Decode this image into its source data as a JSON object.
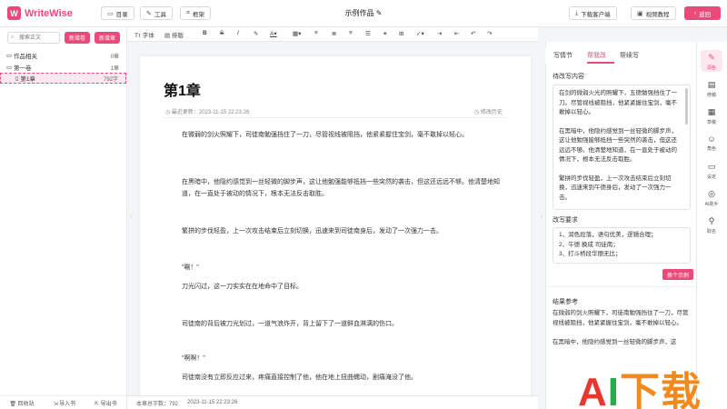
{
  "app": {
    "logo_mark": "W",
    "name": "WriteWise"
  },
  "header": {
    "catalog_label": "目录",
    "tools_label": "工具",
    "frame_label": "框架",
    "doc_title": "示例作品",
    "download_label": "下载客户端",
    "video_label": "视频教程",
    "back_label": "返回"
  },
  "sidebar": {
    "search_placeholder": "搜索正文",
    "new_volume": "新增卷",
    "new_chapter": "新增章",
    "tree": [
      {
        "label": "作品相关",
        "count": "0章"
      },
      {
        "label": "第一卷",
        "count": "1章"
      },
      {
        "label": "第1章",
        "count": "792字"
      }
    ],
    "footer": {
      "recycle": "回收站",
      "import": "导入书",
      "export": "导出书"
    }
  },
  "format_toolbar": {
    "font": "字体",
    "layout": "排版"
  },
  "editor": {
    "chapter_title": "第1章",
    "last_updated": "最近更新：2023-11-15 22:23:26",
    "history": "修改历史",
    "paragraphs": [
      "在微弱的剑火照耀下，司徒南勉强挡住了一刀，尽管视线被阻挡，他紧紧握住宝剑，毫不敢掉以轻心。",
      "在黑暗中，他隐约感觉到一丝轻微的脚步声，这让他勉强能够抵挡一些突然的袭击，但这还远远不够。他清楚地知道，在一直处于被动的情况下，根本无法反击取胜。",
      "繁拼的步伐轻盈，上一次攻击结束后立刻切换，迅速来到司徒南身后，发动了一次强力一击。",
      "“唰！”",
      "刀光闪过，这一刀实实在在地命中了目标。",
      "司徒南的背后被刀光划过，一道气浪炸开，背上留下了一道鲜血淋漓的伤口。",
      "“啊啊！”",
      "司徒南没有立即反应过来，疼痛直接控制了他，他在地上扭曲蠕动，剧痛淹没了他。"
    ]
  },
  "status": {
    "word_count": "本章总字数：792",
    "time": "2023-11-15 22:23:26"
  },
  "right_panel": {
    "tabs": [
      "写情节",
      "帮我改",
      "帮续写"
    ],
    "pending_label": "待改写内容",
    "pending_text": [
      "在剑的微弱火光的照耀下，五德勉强挡住了一刀。尽管视线被阻挡，他紧紧握住宝剑，毫不敢掉以轻心。",
      "在黑暗中，他隐约感觉到一丝轻微的脚步声，这让他勉强能够抵挡一些突然的袭击，但这还远远不够。他清楚地知道，在一直处于被动的情况下，根本无法反击取胜。",
      "繁拼的步伐轻盈，上一次攻击结束后立刻切换，迅速来到午德身后，发动了一次强力一击。"
    ],
    "requirements_label": "改写要求",
    "requirements": [
      "1、润色段落，语句优美，逻辑合理；",
      "2、午德 换成 司徒南；",
      "3、打斗桥段华丽无比；"
    ],
    "generate_label": "换个示例",
    "result_label": "结果参考",
    "result_text": [
      "在微弱的剑火照耀下，司徒南勉强挡住了一刀，尽管视线被阻挡，他紧紧握住宝剑，毫不敢掉以轻心。",
      "在黑暗中，他隐约感觉到一丝轻微的脚步声，这"
    ]
  },
  "rail": [
    {
      "icon": "✎",
      "label": "润色"
    },
    {
      "icon": "▤",
      "label": "修稿"
    },
    {
      "icon": "▦",
      "label": "草稿"
    },
    {
      "icon": "☺",
      "label": "角色"
    },
    {
      "icon": "▭",
      "label": "设定"
    },
    {
      "icon": "◎",
      "label": "AI助手"
    },
    {
      "icon": "⚲",
      "label": "取名"
    }
  ],
  "watermark": {
    "a": "A",
    "i": "I",
    "rest": "下载"
  },
  "colors": {
    "accent": "#e94a7a"
  }
}
